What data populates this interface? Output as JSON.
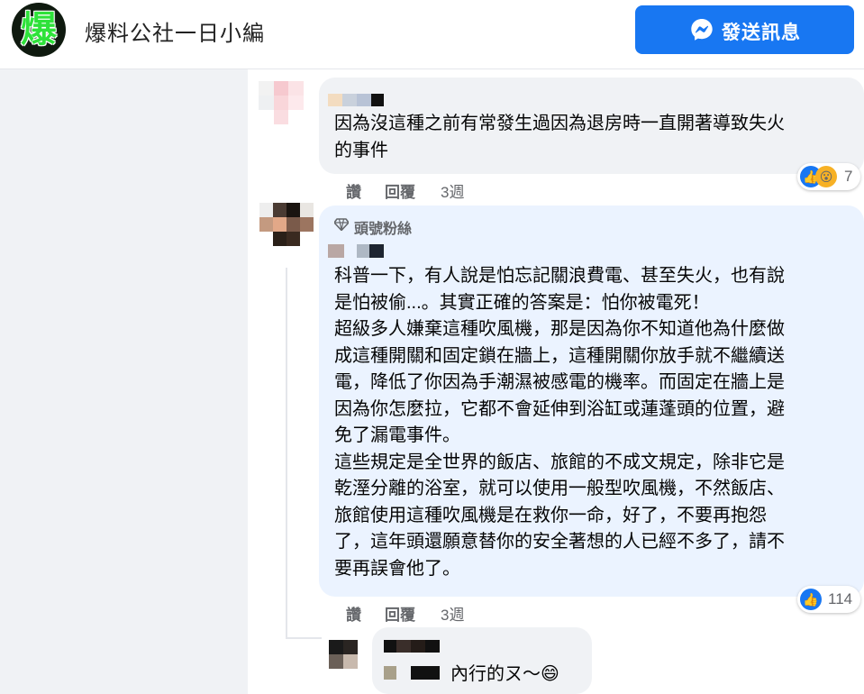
{
  "header": {
    "page_logo_char": "爆",
    "page_name": "爆料公社一日小編",
    "message_button": "發送訊息"
  },
  "comments": [
    {
      "lines": [
        "因為沒這種之前有常發生過因為退房時一直開著導致失火",
        "的事件"
      ],
      "actions": {
        "like": "讚",
        "reply": "回覆",
        "time": "3週"
      },
      "reactions": {
        "icons": [
          "like-icon",
          "wow-icon"
        ],
        "count": "7"
      }
    },
    {
      "badge": "頭號粉絲",
      "lines": [
        "科普一下，有人說是怕忘記關浪費電、甚至失火，也有說",
        "是怕被偷...。其實正確的答案是：怕你被電死！",
        "超級多人嫌棄這種吹風機，那是因為你不知道他為什麼做",
        "成這種開關和固定鎖在牆上，這種開關你放手就不繼續送",
        "電，降低了你因為手潮濕被感電的機率。而固定在牆上是",
        "因為你怎麼拉，它都不會延伸到浴缸或蓮蓬頭的位置，避",
        "免了漏電事件。",
        "這些規定是全世界的飯店、旅館的不成文規定，除非它是",
        "乾溼分離的浴室，就可以使用一般型吹風機，不然飯店、",
        "旅館使用這種吹風機是在救你一命，好了，不要再抱怨",
        "了，這年頭還願意替你的安全著想的人已經不多了，請不",
        "要再誤會他了。"
      ],
      "actions": {
        "like": "讚",
        "reply": "回覆",
        "time": "3週"
      },
      "reactions": {
        "icons": [
          "like-icon"
        ],
        "count": "114"
      }
    },
    {
      "text": "內行的ㄡ～",
      "emoji": "😄"
    }
  ],
  "colors": {
    "accent": "#1877f2",
    "bubble": "#f0f2f5",
    "bubble_highlight": "#ebf3ff"
  }
}
